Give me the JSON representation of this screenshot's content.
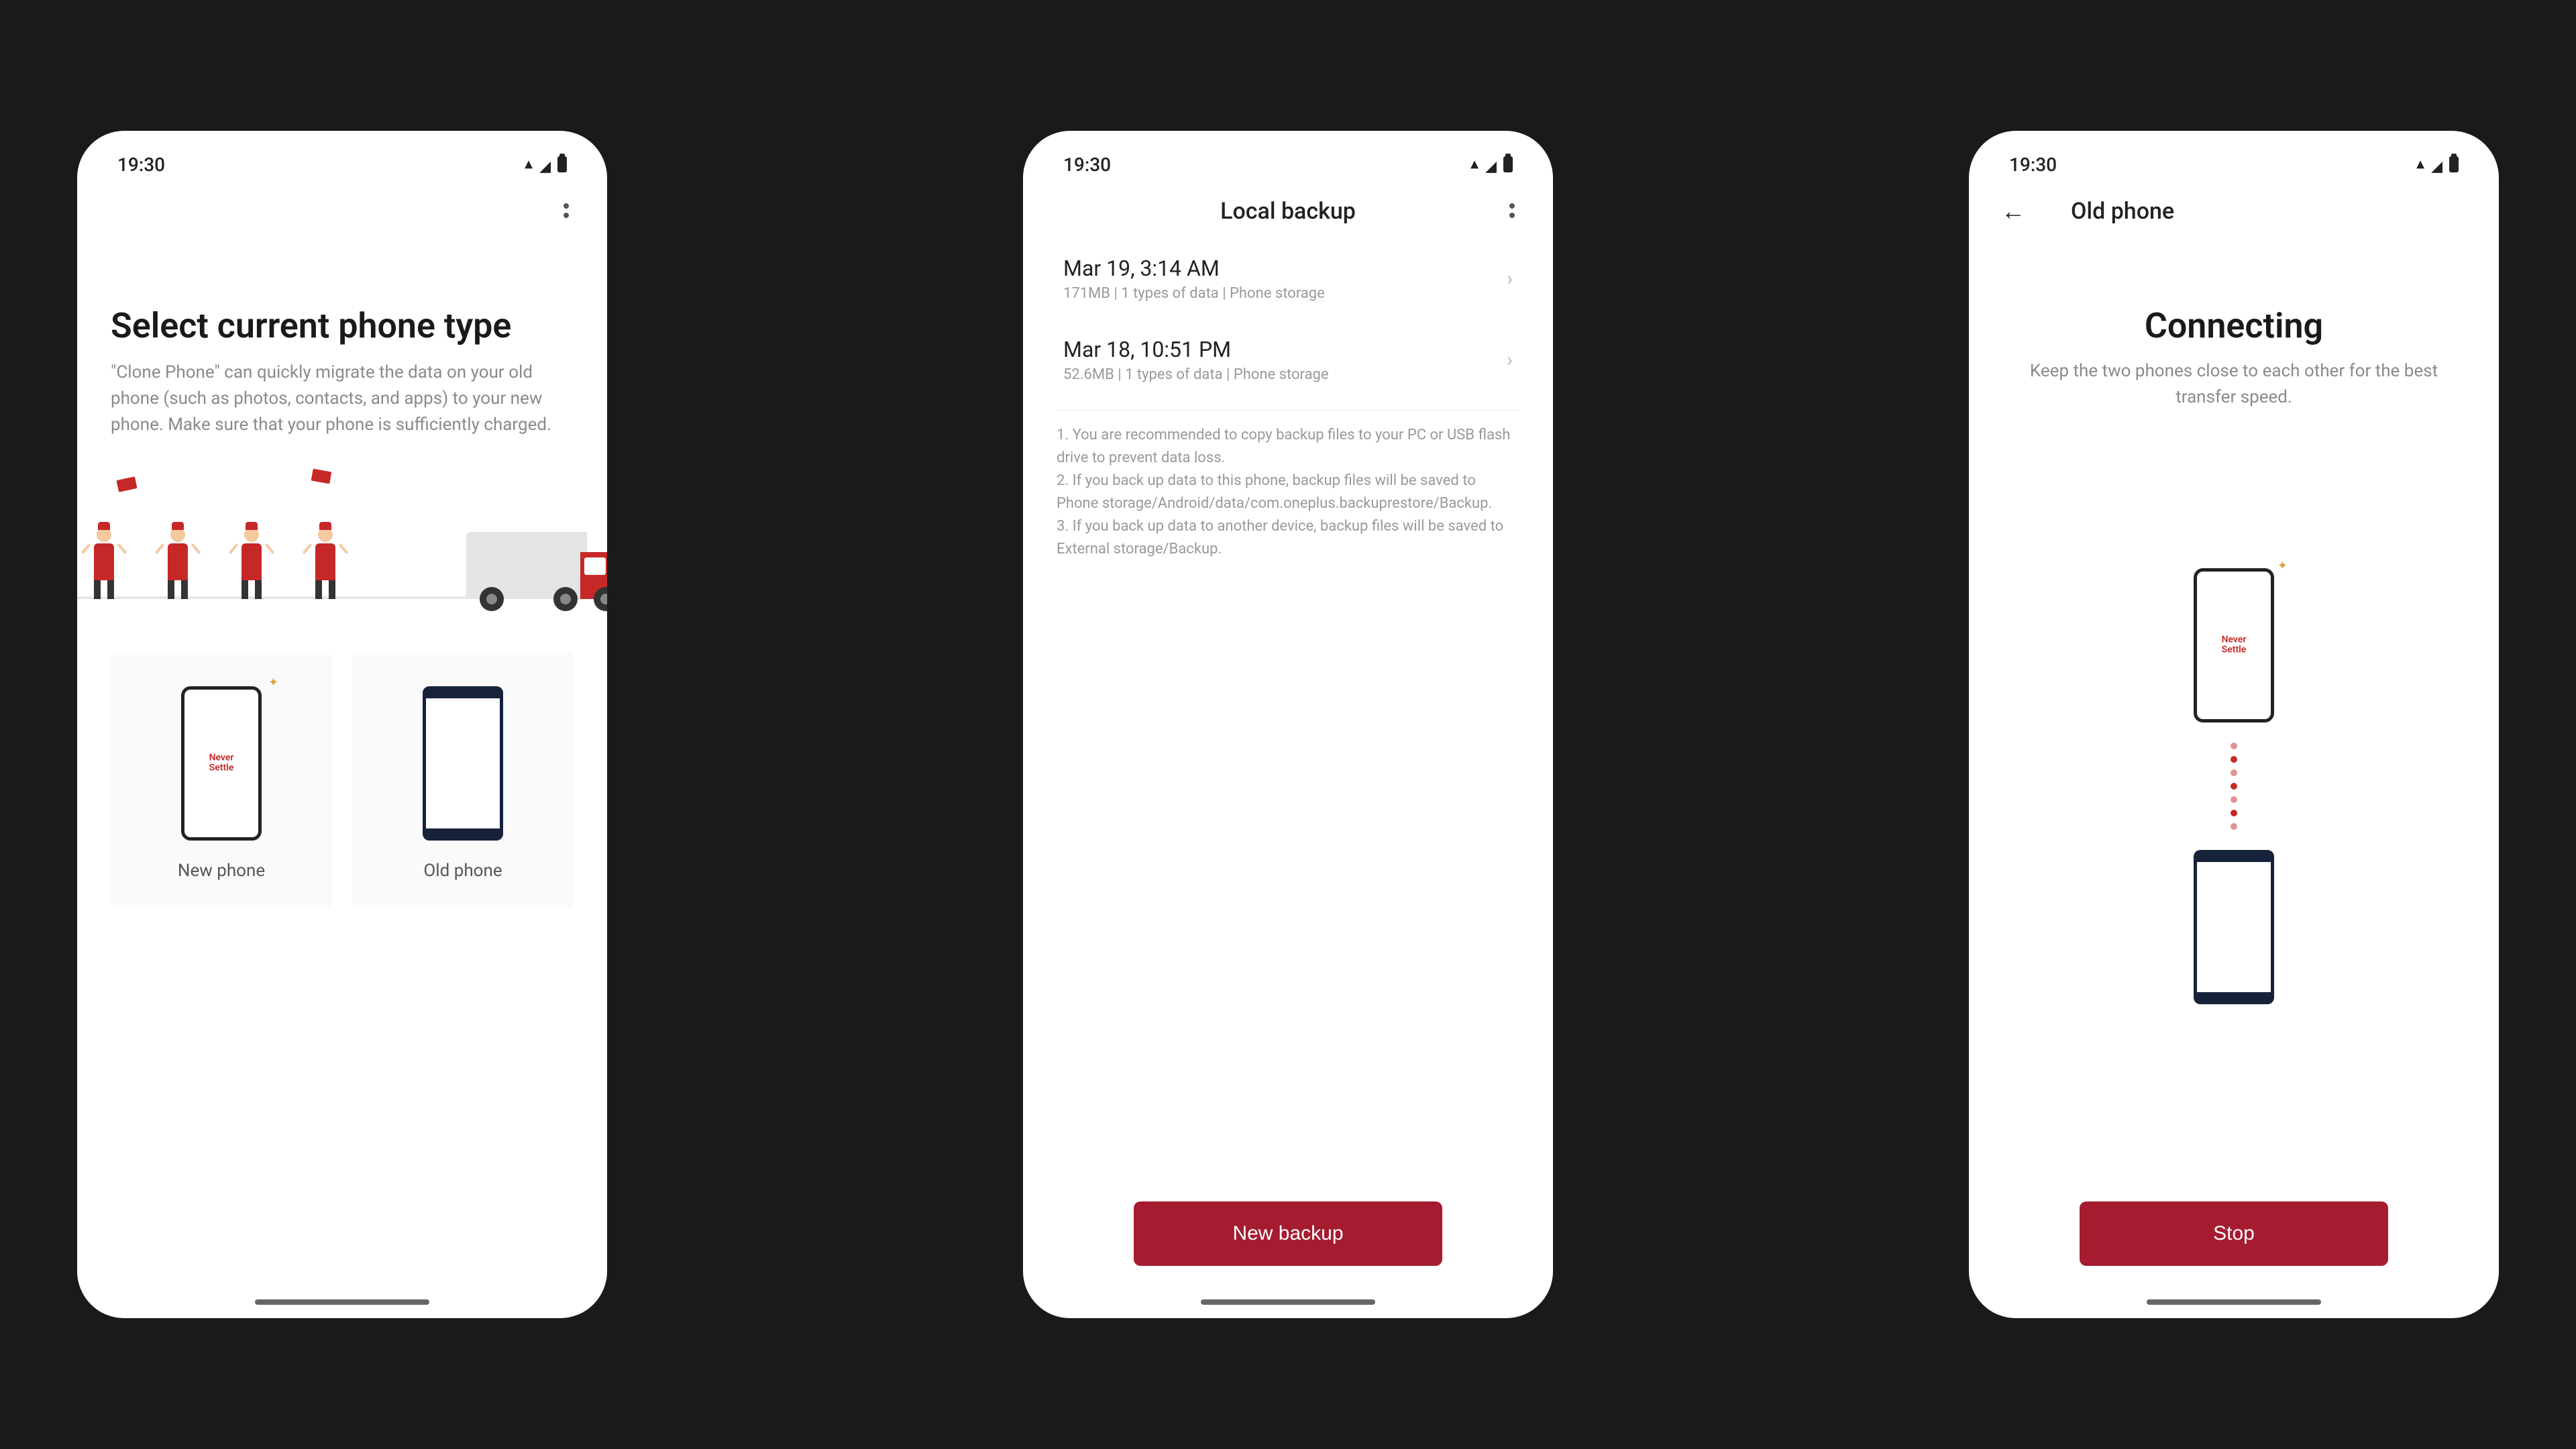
{
  "status": {
    "time": "19:30"
  },
  "screen1": {
    "title": "Select current phone type",
    "description": "\"Clone Phone\" can quickly migrate the data on your old phone (such as photos, contacts, and apps) to your new phone. Make sure that your phone is sufficiently charged.",
    "new_label": "New phone",
    "old_label": "Old phone"
  },
  "screen2": {
    "title": "Local backup",
    "backups": [
      {
        "title": "Mar 19, 3:14 AM",
        "sub": "171MB  | 1 types of data   | Phone storage"
      },
      {
        "title": "Mar 18, 10:51 PM",
        "sub": "52.6MB  | 1 types of data   | Phone storage"
      }
    ],
    "note1": "1. You are recommended to copy backup files to your PC or USB flash drive to prevent data loss.",
    "note2": "2. If you back up data to this phone, backup files will be saved to Phone storage/Android/data/com.oneplus.backuprestore/Backup.",
    "note3": "3. If you back up data to another device, backup files will be saved to External storage/Backup.",
    "button": "New backup"
  },
  "screen3": {
    "header": "Old phone",
    "title": "Connecting",
    "description": "Keep the two phones close to each other for the best transfer speed.",
    "button": "Stop"
  }
}
